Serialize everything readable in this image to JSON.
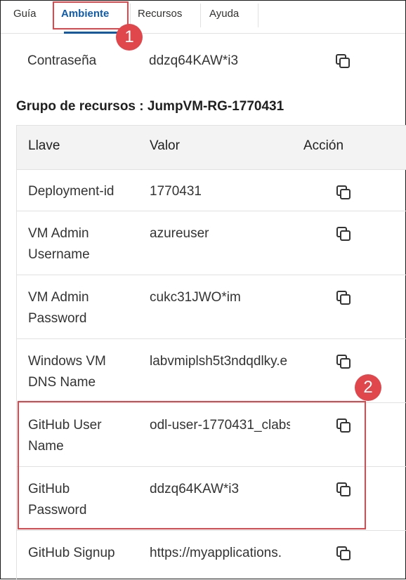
{
  "tabs": [
    "Guía",
    "Ambiente",
    "Recursos",
    "Ayuda"
  ],
  "active_tab": "Ambiente",
  "markers": [
    "1",
    "2"
  ],
  "top_row": {
    "key": [
      "Contraseña"
    ],
    "value": "ddzq64KAW*i3"
  },
  "group_title": "Grupo de recursos : JumpVM-RG-1770431",
  "table": {
    "headers": {
      "key": "Llave",
      "value": "Valor",
      "action": "Acción"
    },
    "rows": [
      {
        "key": [
          "Deployment-id"
        ],
        "value": "1770431"
      },
      {
        "key": [
          "VM Admin",
          "Username"
        ],
        "value": "azureuser"
      },
      {
        "key": [
          "VM Admin",
          "Password"
        ],
        "value": "cukc31JWO*im"
      },
      {
        "key": [
          "Windows VM",
          "DNS Name"
        ],
        "value": "labvmiplsh5t3ndqdlky.e"
      },
      {
        "key": [
          "GitHub User",
          "Name"
        ],
        "value": "odl-user-1770431_clabs"
      },
      {
        "key": [
          "GitHub",
          "Password"
        ],
        "value": "ddzq64KAW*i3"
      },
      {
        "key": [
          "GitHub Signup"
        ],
        "value": "https://myapplications."
      }
    ]
  },
  "icons": {
    "copy": "copy-icon"
  },
  "colors": {
    "accent": "#0f5ba8",
    "highlight": "#e0474c"
  }
}
